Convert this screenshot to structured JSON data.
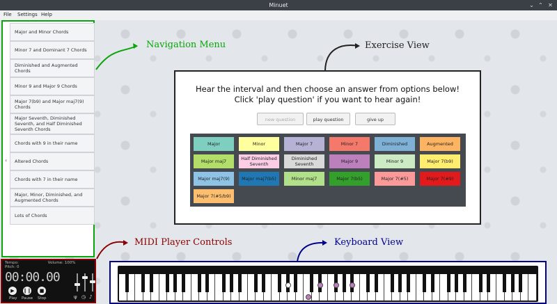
{
  "window": {
    "title": "Minuet",
    "minimize_icon": "minimize-icon",
    "maximize_icon": "maximize-icon",
    "close_icon": "close-icon"
  },
  "menu": [
    "File",
    "Settings",
    "Help"
  ],
  "navigation": {
    "items": [
      "Major and Minor Chords",
      "Minor 7 and Dominant 7 Chords",
      "Diminished and Augmented Chords",
      "Minor 9 and Major 9 Chords",
      "Major 7(b9) and Major maj7(9) Chords",
      "Major Seventh, Diminished Seventh, and Half Diminished Seventh Chords",
      "Chords with 9 in their name",
      "Altered Chords",
      "Chords with 7 in their name",
      "Major, Minor, Diminished, and Augmented Chords",
      "Lots of Chords"
    ]
  },
  "exercise": {
    "question_line1": "Hear the interval and then choose an answer from options below!",
    "question_line2": "Click 'play question' if you want to hear again!",
    "new_question": "new question",
    "play_question": "play question",
    "give_up": "give up",
    "answers": [
      {
        "label": "Major",
        "color": "#7fcfc0"
      },
      {
        "label": "Minor",
        "color": "#ffff9e"
      },
      {
        "label": "Major 7",
        "color": "#b5b2d6"
      },
      {
        "label": "Minor 7",
        "color": "#f4796a"
      },
      {
        "label": "Diminished",
        "color": "#7fb0d6"
      },
      {
        "label": "Augmented",
        "color": "#fdb462"
      },
      {
        "label": "Major maj7",
        "color": "#b3de69"
      },
      {
        "label": "Half Diminished Seventh",
        "color": "#fccde5"
      },
      {
        "label": "Diminished Seventh",
        "color": "#d9d9d9"
      },
      {
        "label": "Major 9",
        "color": "#bc80bd"
      },
      {
        "label": "Minor 9",
        "color": "#ccebc5"
      },
      {
        "label": "Major 7(b9)",
        "color": "#ffed6f"
      },
      {
        "label": "Major maj7(9)",
        "color": "#8ec3e6"
      },
      {
        "label": "Major maj7(b5)",
        "color": "#1f78b4"
      },
      {
        "label": "Minor maj7",
        "color": "#b2df8a"
      },
      {
        "label": "Major 7(b5)",
        "color": "#33a02c"
      },
      {
        "label": "Major 7(#5)",
        "color": "#fb9a99"
      },
      {
        "label": "Major 7(#9)",
        "color": "#e31a1c"
      },
      {
        "label": "Major 7(#5/b9)",
        "color": "#fdbf6f"
      }
    ]
  },
  "midi": {
    "tempo_label": "Tempo:",
    "volume_label": "Volume: 100%",
    "pitch_label": "Pitch: 0",
    "time": "00:00.00",
    "play": "Play",
    "pause": "Pause",
    "stop": "Stop"
  },
  "annotations": {
    "navigation_menu": "Navigation Menu",
    "exercise_view": "Exercise View",
    "midi_player_controls": "MIDI Player Controls",
    "keyboard_view": "Keyboard View"
  },
  "colors": {
    "nav_frame": "#0aa50a",
    "midi_frame": "#8b0000",
    "keyboard_frame": "#00008b",
    "exercise_frame": "#222222",
    "note_marker": "#bc80bd"
  }
}
